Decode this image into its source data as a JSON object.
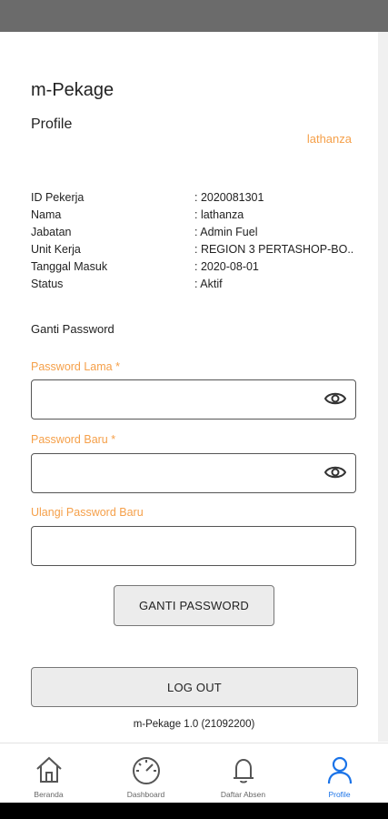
{
  "app": {
    "title": "m-Pekage",
    "version": "m-Pekage 1.0 (21092200)"
  },
  "profile": {
    "section_title": "Profile",
    "username": "lathanza",
    "info": [
      {
        "label": "ID Pekerja",
        "value": ": 2020081301"
      },
      {
        "label": "Nama",
        "value": ": lathanza"
      },
      {
        "label": "Jabatan",
        "value": ": Admin Fuel"
      },
      {
        "label": "Unit Kerja",
        "value": ": REGION 3 PERTASHOP-BO.."
      },
      {
        "label": "Tanggal Masuk",
        "value": ": 2020-08-01"
      },
      {
        "label": "Status",
        "value": ": Aktif"
      }
    ]
  },
  "change_password": {
    "title": "Ganti Password",
    "old_label": "Password Lama *",
    "new_label": "Password Baru *",
    "repeat_label": "Ulangi Password Baru",
    "old_value": "",
    "new_value": "",
    "repeat_value": "",
    "button": "GANTI PASSWORD"
  },
  "logout_button": "LOG OUT",
  "nav": [
    {
      "label": "Beranda",
      "icon": "home-icon"
    },
    {
      "label": "Dashboard",
      "icon": "speedometer-icon"
    },
    {
      "label": "Daftar Absen",
      "icon": "bell-icon"
    },
    {
      "label": "Profile",
      "icon": "person-icon",
      "active": true
    }
  ],
  "colors": {
    "accent": "#f5a04a",
    "active_nav": "#1a73e8",
    "status_bar": "#6b6b6b"
  }
}
